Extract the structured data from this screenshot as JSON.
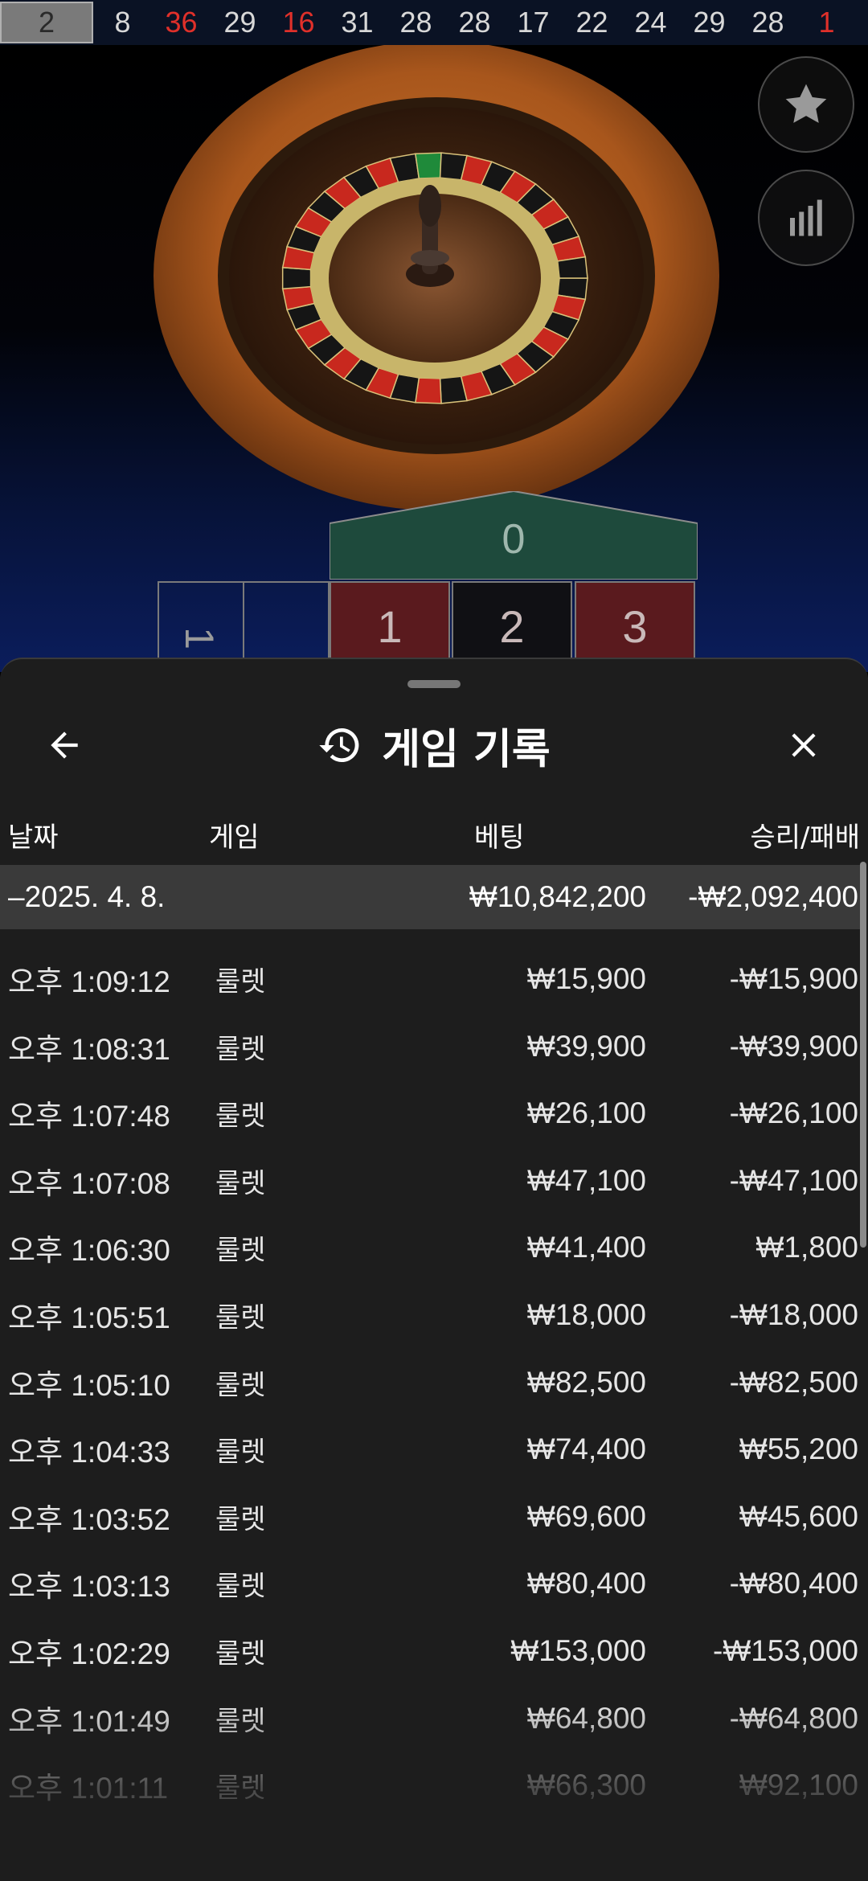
{
  "results_strip": {
    "numbers": [
      {
        "value": "2",
        "color": "#2a2a2a"
      },
      {
        "value": "8",
        "color": "#d8d8d8"
      },
      {
        "value": "36",
        "color": "#e0302a"
      },
      {
        "value": "29",
        "color": "#d8d8d8"
      },
      {
        "value": "16",
        "color": "#e0302a"
      },
      {
        "value": "31",
        "color": "#d8d8d8"
      },
      {
        "value": "28",
        "color": "#d8d8d8"
      },
      {
        "value": "28",
        "color": "#d8d8d8"
      },
      {
        "value": "17",
        "color": "#d8d8d8"
      },
      {
        "value": "22",
        "color": "#d8d8d8"
      },
      {
        "value": "24",
        "color": "#d8d8d8"
      },
      {
        "value": "29",
        "color": "#d8d8d8"
      },
      {
        "value": "28",
        "color": "#d8d8d8"
      },
      {
        "value": "1",
        "color": "#e0302a"
      }
    ]
  },
  "side_buttons": {
    "favorite_icon": "star-icon",
    "stats_icon": "bar-chart-icon"
  },
  "table": {
    "zero": "0",
    "left_partial": "1",
    "cells": [
      {
        "label": "1",
        "color": "#5a1a1e"
      },
      {
        "label": "2",
        "color": "#101014"
      },
      {
        "label": "3",
        "color": "#5a1a1e"
      }
    ]
  },
  "panel": {
    "title": "게임 기록",
    "back_icon": "arrow-left-icon",
    "history_icon": "history-icon",
    "close_icon": "close-icon",
    "columns": {
      "date": "날짜",
      "game": "게임",
      "bet": "베팅",
      "result": "승리/패배"
    },
    "date_group": {
      "date": "–2025. 4. 8.",
      "bet_total": "₩10,842,200",
      "result_total": "-₩2,092,400"
    },
    "rows": [
      {
        "time": "오후 1:09:12",
        "game": "룰렛",
        "bet": "₩15,900",
        "result": "-₩15,900"
      },
      {
        "time": "오후 1:08:31",
        "game": "룰렛",
        "bet": "₩39,900",
        "result": "-₩39,900"
      },
      {
        "time": "오후 1:07:48",
        "game": "룰렛",
        "bet": "₩26,100",
        "result": "-₩26,100"
      },
      {
        "time": "오후 1:07:08",
        "game": "룰렛",
        "bet": "₩47,100",
        "result": "-₩47,100"
      },
      {
        "time": "오후 1:06:30",
        "game": "룰렛",
        "bet": "₩41,400",
        "result": "₩1,800"
      },
      {
        "time": "오후 1:05:51",
        "game": "룰렛",
        "bet": "₩18,000",
        "result": "-₩18,000"
      },
      {
        "time": "오후 1:05:10",
        "game": "룰렛",
        "bet": "₩82,500",
        "result": "-₩82,500"
      },
      {
        "time": "오후 1:04:33",
        "game": "룰렛",
        "bet": "₩74,400",
        "result": "₩55,200"
      },
      {
        "time": "오후 1:03:52",
        "game": "룰렛",
        "bet": "₩69,600",
        "result": "₩45,600"
      },
      {
        "time": "오후 1:03:13",
        "game": "룰렛",
        "bet": "₩80,400",
        "result": "-₩80,400"
      },
      {
        "time": "오후 1:02:29",
        "game": "룰렛",
        "bet": "₩153,000",
        "result": "-₩153,000"
      },
      {
        "time": "오후 1:01:49",
        "game": "룰렛",
        "bet": "₩64,800",
        "result": "-₩64,800"
      },
      {
        "time": "오후 1:01:11",
        "game": "룰렛",
        "bet": "₩66,300",
        "result": "₩92,100"
      }
    ]
  }
}
